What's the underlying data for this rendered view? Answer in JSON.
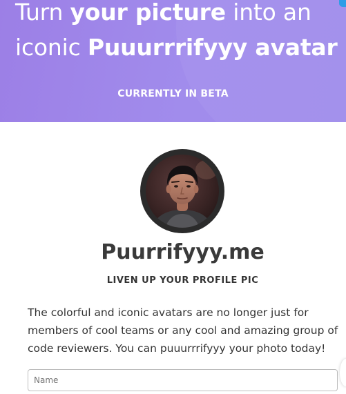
{
  "hero": {
    "title_lines": [
      {
        "pre": "Turn ",
        "bold": "your picture",
        "post": " into an"
      },
      {
        "pre": "iconic ",
        "bold": "Puuurrrifyyy avatar",
        "post": ""
      }
    ],
    "beta_label": "CURRENTLY IN BETA",
    "background_color": "#9f86e8"
  },
  "profile": {
    "avatar": "user-portrait"
  },
  "content": {
    "site_title": "Puurrifyyy.me",
    "tagline": "LIVEN UP YOUR PROFILE PIC",
    "description": "The colorful and iconic avatars are no longer just for members of cool teams or any cool and amazing group of code reviewers. You can puuurrrifyyy your photo today!"
  },
  "form": {
    "name_field": {
      "value": "",
      "placeholder": "Name"
    }
  }
}
